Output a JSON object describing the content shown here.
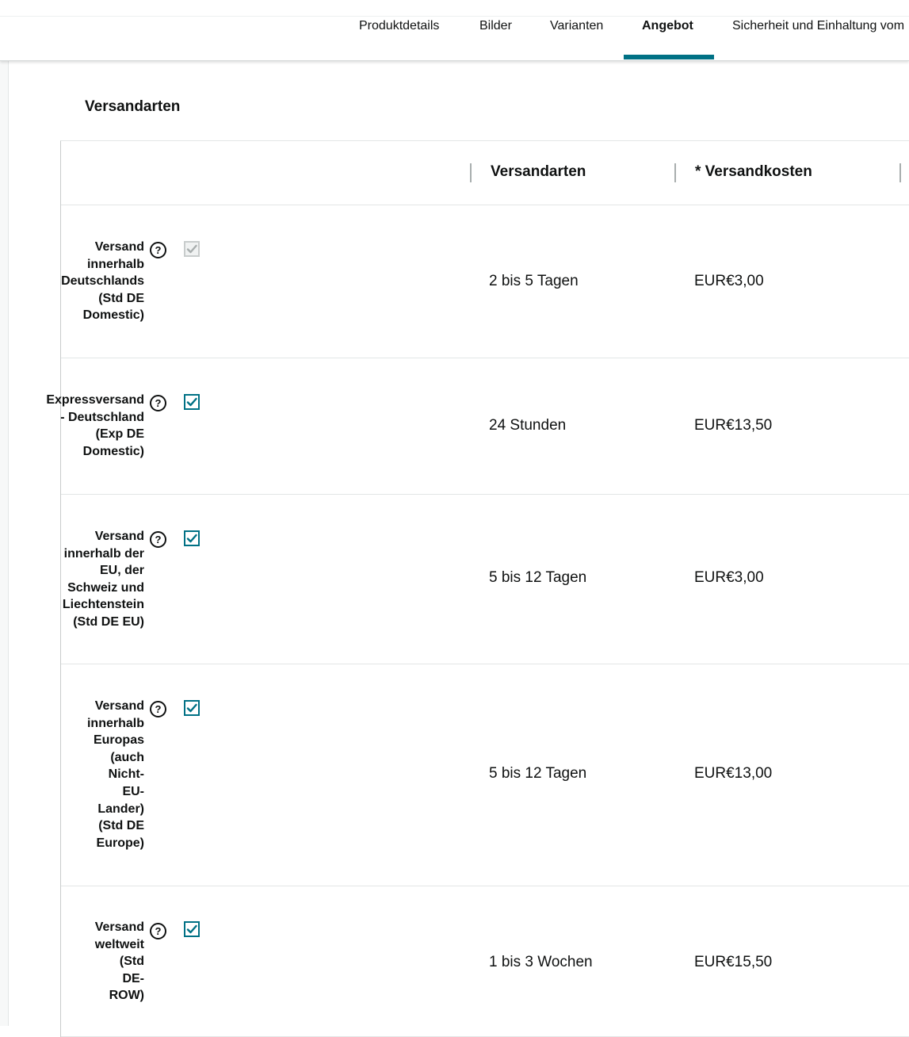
{
  "nav": {
    "tabs": [
      {
        "label": "Produktdetails"
      },
      {
        "label": "Bilder"
      },
      {
        "label": "Varianten"
      },
      {
        "label": "Angebot"
      },
      {
        "label": "Sicherheit und Einhaltung vom"
      }
    ],
    "active_tab": "Angebot"
  },
  "section": {
    "title": "Versandarten"
  },
  "table": {
    "headers": [
      "Versandarten",
      "* Versandkosten"
    ],
    "rows": [
      {
        "label_lines": [
          "Versand",
          "innerhalb",
          "Deutschlands",
          "(Std DE",
          "Domestic)"
        ],
        "checked": true,
        "disabled": true,
        "duration": "2 bis 5 Tagen",
        "cost": "EUR€3,00"
      },
      {
        "label_lines": [
          "Expressversand",
          "- Deutschland",
          "(Exp DE",
          "Domestic)"
        ],
        "checked": true,
        "disabled": false,
        "duration": "24 Stunden",
        "cost": "EUR€13,50"
      },
      {
        "label_lines": [
          "Versand",
          "innerhalb der",
          "EU, der",
          "Schweiz und",
          "Liechtenstein",
          "(Std DE EU)"
        ],
        "checked": true,
        "disabled": false,
        "duration": "5 bis 12 Tagen",
        "cost": "EUR€3,00"
      },
      {
        "label_lines": [
          "Versand",
          "innerhalb",
          "Europas",
          "(auch",
          "Nicht-",
          "EU-",
          "Lander)",
          "(Std DE",
          "Europe)"
        ],
        "checked": true,
        "disabled": false,
        "duration": "5 bis 12 Tagen",
        "cost": "EUR€13,00"
      },
      {
        "label_lines": [
          "Versand",
          "weltweit",
          "(Std",
          "DE-",
          "ROW)"
        ],
        "checked": true,
        "disabled": false,
        "duration": "1 bis 3 Wochen",
        "cost": "EUR€15,50"
      }
    ]
  },
  "colors": {
    "accent": "#007185",
    "text": "#0f1111",
    "border": "#e3e6e6"
  },
  "icons": {
    "help": "help-circle-icon",
    "check": "checkmark-icon"
  }
}
